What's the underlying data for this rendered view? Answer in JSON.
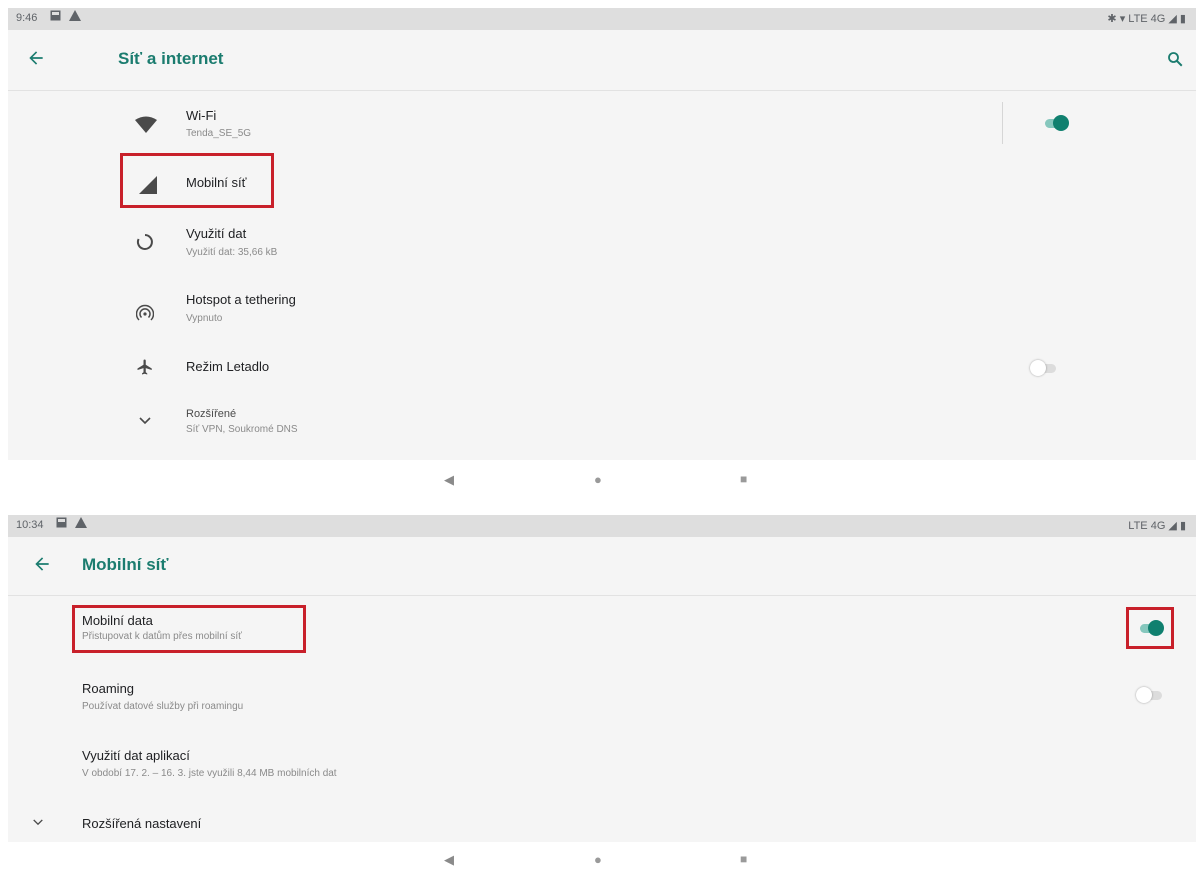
{
  "colors": {
    "accent": "#1b7c6f",
    "highlight": "#c8202a",
    "toggle_on": "#10806f"
  },
  "screen1": {
    "status": {
      "time": "9:46",
      "right": "✱ ▾ LTE 4G ◢ ▮"
    },
    "appbar": {
      "title": "Síť a internet",
      "back_icon": "arrow-back-icon",
      "search_icon": "search-icon"
    },
    "items": [
      {
        "icon": "wifi-icon",
        "title": "Wi-Fi",
        "subtitle": "Tenda_SE_5G",
        "toggle": true
      },
      {
        "icon": "cellular-signal-icon",
        "title": "Mobilní síť",
        "highlighted": true
      },
      {
        "icon": "data-usage-icon",
        "title": "Využití dat",
        "subtitle": "Využití dat: 35,66 kB"
      },
      {
        "icon": "hotspot-icon",
        "title": "Hotspot a tethering",
        "subtitle": "Vypnuto"
      },
      {
        "icon": "airplane-icon",
        "title": "Režim Letadlo",
        "toggle": false
      },
      {
        "icon": "chevron-down-icon",
        "title": "Rozšířené",
        "subtitle": "Síť VPN, Soukromé DNS"
      }
    ]
  },
  "screen2": {
    "status": {
      "time": "10:34",
      "right": "LTE 4G ◢ ▮"
    },
    "appbar": {
      "title": "Mobilní síť",
      "back_icon": "arrow-back-icon"
    },
    "items": [
      {
        "title": "Mobilní data",
        "subtitle": "Přistupovat k datům přes mobilní síť",
        "toggle": true,
        "highlighted": true
      },
      {
        "title": "Roaming",
        "subtitle": "Používat datové služby při roamingu",
        "toggle": false
      },
      {
        "title": "Využití dat aplikací",
        "subtitle": "V období 17. 2. – 16. 3. jste využili 8,44 MB mobilních dat"
      },
      {
        "icon": "chevron-down-icon",
        "title": "Rozšířená nastavení"
      }
    ]
  },
  "navbar": {
    "back": "◀",
    "home": "●",
    "recents": "■"
  }
}
